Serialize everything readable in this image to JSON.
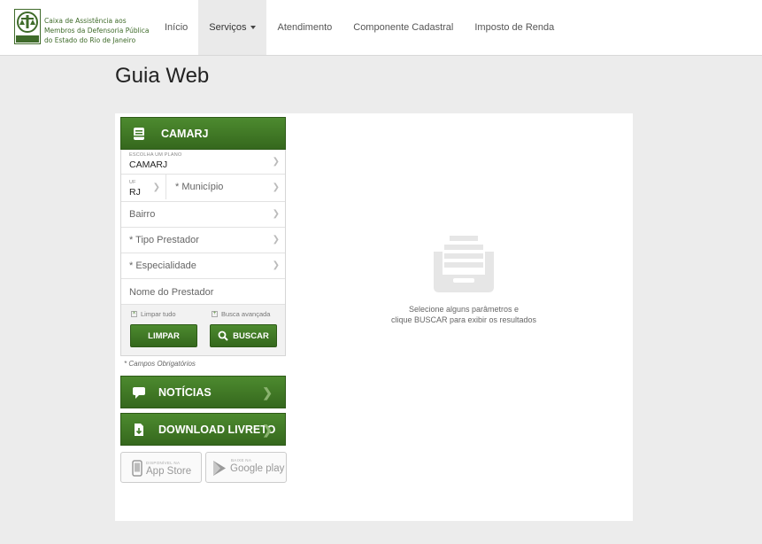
{
  "header": {
    "logo_text_lines": [
      "Caixa de Assistência aos",
      "Membros da Defensoria Pública",
      "do Estado do Rio de Janeiro"
    ],
    "logo_mark_text": "CAMARJ",
    "nav": [
      {
        "label": "Início"
      },
      {
        "label": "Serviços"
      },
      {
        "label": "Atendimento"
      },
      {
        "label": "Componente Cadastral"
      },
      {
        "label": "Imposto de Renda"
      }
    ]
  },
  "page": {
    "title": "Guia Web"
  },
  "search_panel": {
    "title": "CAMARJ",
    "plan": {
      "label": "ESCOLHA UM PLANO",
      "value": "CAMARJ"
    },
    "uf": {
      "label": "UF",
      "value": "RJ"
    },
    "municipio": {
      "label": "Município",
      "required_mark": "*"
    },
    "bairro": {
      "label": "Bairro"
    },
    "tipo_prestador": {
      "label": "Tipo Prestador",
      "required_mark": "*"
    },
    "especialidade": {
      "label": "Especialidade",
      "required_mark": "*"
    },
    "nome_prestador": {
      "placeholder": "Nome do Prestador"
    },
    "limpar_tudo": "Limpar tudo",
    "busca_avancada": "Busca avançada",
    "limpar_button": "LIMPAR",
    "buscar_button": "BUSCAR",
    "required_note": "* Campos Obrigatórios"
  },
  "noticias": {
    "label": "NOTÍCIAS"
  },
  "download": {
    "label": "DOWNLOAD LIVRETO"
  },
  "app_store": {
    "small": "DISPONÍVEL NA",
    "big": "App Store"
  },
  "google_play": {
    "small": "BAIXE NA",
    "big": "Google play"
  },
  "empty_state": {
    "line1": "Selecione alguns parâmetros e",
    "line2": "clique BUSCAR para exibir os resultados"
  },
  "colors": {
    "accent_green": "#3f7a24",
    "panel_bg": "#ffffff",
    "page_bg": "#ececec"
  }
}
